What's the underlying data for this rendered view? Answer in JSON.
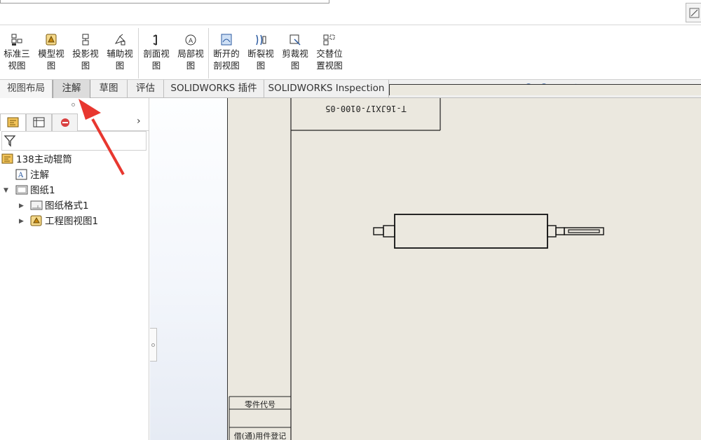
{
  "ribbon": {
    "buttons": [
      {
        "label": "标准三\n视图",
        "icon": "standard-3view-icon"
      },
      {
        "label": "模型视\n图",
        "icon": "model-view-icon"
      },
      {
        "label": "投影视\n图",
        "icon": "projected-view-icon"
      },
      {
        "label": "辅助视\n图",
        "icon": "auxiliary-view-icon"
      },
      {
        "label": "剖面视\n图",
        "icon": "section-view-icon"
      },
      {
        "label": "局部视\n图",
        "icon": "detail-view-icon"
      },
      {
        "label": "断开的\n剖视图",
        "icon": "broken-out-section-icon"
      },
      {
        "label": "断裂视\n图",
        "icon": "break-view-icon"
      },
      {
        "label": "剪裁视\n图",
        "icon": "crop-view-icon"
      },
      {
        "label": "交替位\n置视图",
        "icon": "alternate-position-icon"
      }
    ]
  },
  "tabs": [
    {
      "label": "视图布局"
    },
    {
      "label": "注解"
    },
    {
      "label": "草图"
    },
    {
      "label": "评估"
    },
    {
      "label": "SOLIDWORKS 插件"
    },
    {
      "label": "SOLIDWORKS Inspection"
    }
  ],
  "tree": {
    "root": "138主动辊筒",
    "items": [
      {
        "label": "注解",
        "icon": "annotation-icon"
      },
      {
        "label": "图纸1",
        "icon": "sheet-icon"
      },
      {
        "label": "图纸格式1",
        "icon": "sheet-format-icon"
      },
      {
        "label": "工程图视图1",
        "icon": "drawing-view-icon"
      }
    ]
  },
  "drawing": {
    "title_code": "T-16JX17-0100-05",
    "stamp_part_code": "零件代号",
    "stamp_usage": "借(通)用件登记"
  },
  "colors": {
    "sheet_bg": "#ebe8df",
    "arrow": "#e8372f",
    "active_tab": "#dcdcdc"
  }
}
